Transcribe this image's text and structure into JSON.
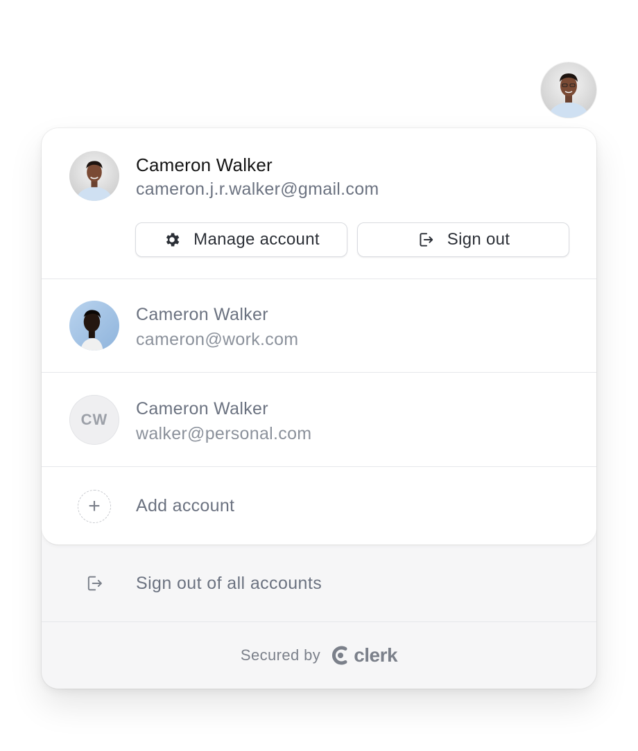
{
  "trigger": {
    "avatar": "user-photo-avatar"
  },
  "active_account": {
    "name": "Cameron Walker",
    "email": "cameron.j.r.walker@gmail.com",
    "avatar": "user-photo-avatar",
    "manage_label": "Manage account",
    "manage_icon": "gear-icon",
    "signout_label": "Sign out",
    "signout_icon": "sign-out-icon"
  },
  "other_accounts": [
    {
      "name": "Cameron Walker",
      "email": "cameron@work.com",
      "avatar": "user-photo-avatar"
    },
    {
      "name": "Cameron Walker",
      "email": "walker@personal.com",
      "initials": "CW"
    }
  ],
  "add_account": {
    "label": "Add account",
    "icon": "plus-icon"
  },
  "sign_out_all": {
    "label": "Sign out of all accounts",
    "icon": "sign-out-icon"
  },
  "footer": {
    "secured_by": "Secured by",
    "brand": "clerk",
    "brand_icon": "clerk-logo-icon"
  },
  "colors": {
    "text_primary": "#141414",
    "text_secondary": "#6b7280",
    "footer_bg": "#f6f6f7",
    "border": "#e6e7ea"
  }
}
